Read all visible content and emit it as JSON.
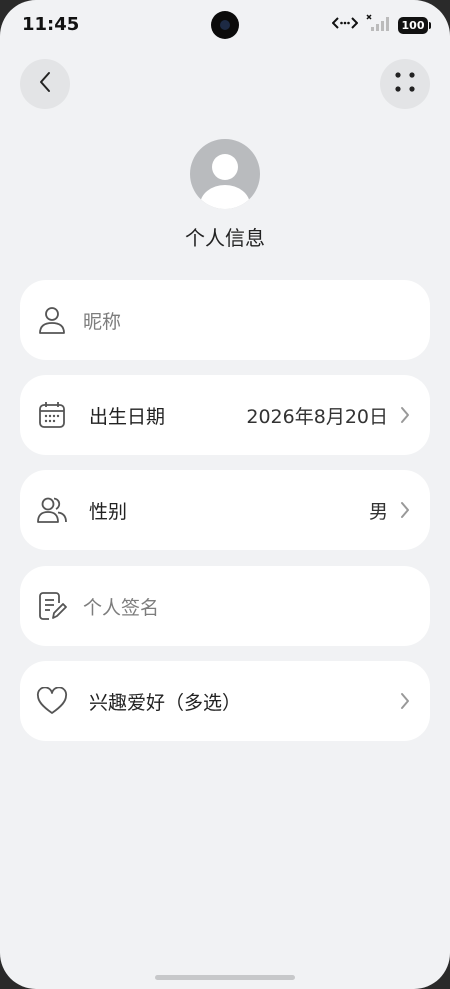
{
  "status_bar": {
    "time": "11:45",
    "battery": "100"
  },
  "profile": {
    "title": "个人信息"
  },
  "fields": {
    "nickname": {
      "placeholder": "昵称"
    },
    "birthday": {
      "label": "出生日期",
      "value": "2026年8月20日"
    },
    "gender": {
      "label": "性别",
      "value": "男"
    },
    "signature": {
      "placeholder": "个人签名"
    },
    "hobbies": {
      "label": "兴趣爱好（多选）"
    }
  }
}
